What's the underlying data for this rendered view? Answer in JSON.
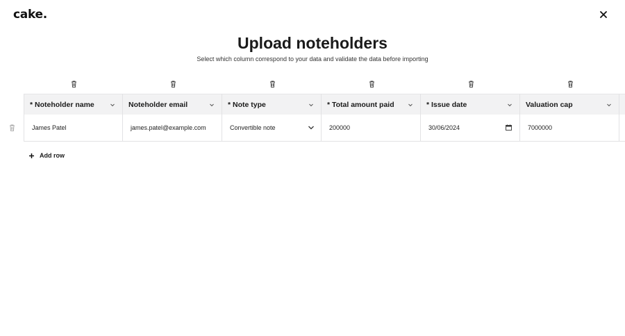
{
  "app": {
    "logo": "cake."
  },
  "header": {
    "title": "Upload noteholders",
    "subtitle": "Select which column correspond to your data and validate the data before importing"
  },
  "icons": {
    "close": "close-icon",
    "trash": "trash-icon",
    "chevron": "chevron-down-icon",
    "calendar": "calendar-icon",
    "plus": "plus-icon"
  },
  "table": {
    "columns": [
      {
        "label": "* Noteholder name"
      },
      {
        "label": "Noteholder email"
      },
      {
        "label": "* Note type"
      },
      {
        "label": "* Total amount paid"
      },
      {
        "label": "* Issue date"
      },
      {
        "label": "Valuation cap"
      },
      {
        "label": ""
      }
    ],
    "rows": [
      [
        "James Patel",
        "james.patel@example.com",
        "Convertible note",
        "200000",
        "30/06/2024",
        "7000000",
        ""
      ]
    ]
  },
  "actions": {
    "add_row": "Add row"
  }
}
